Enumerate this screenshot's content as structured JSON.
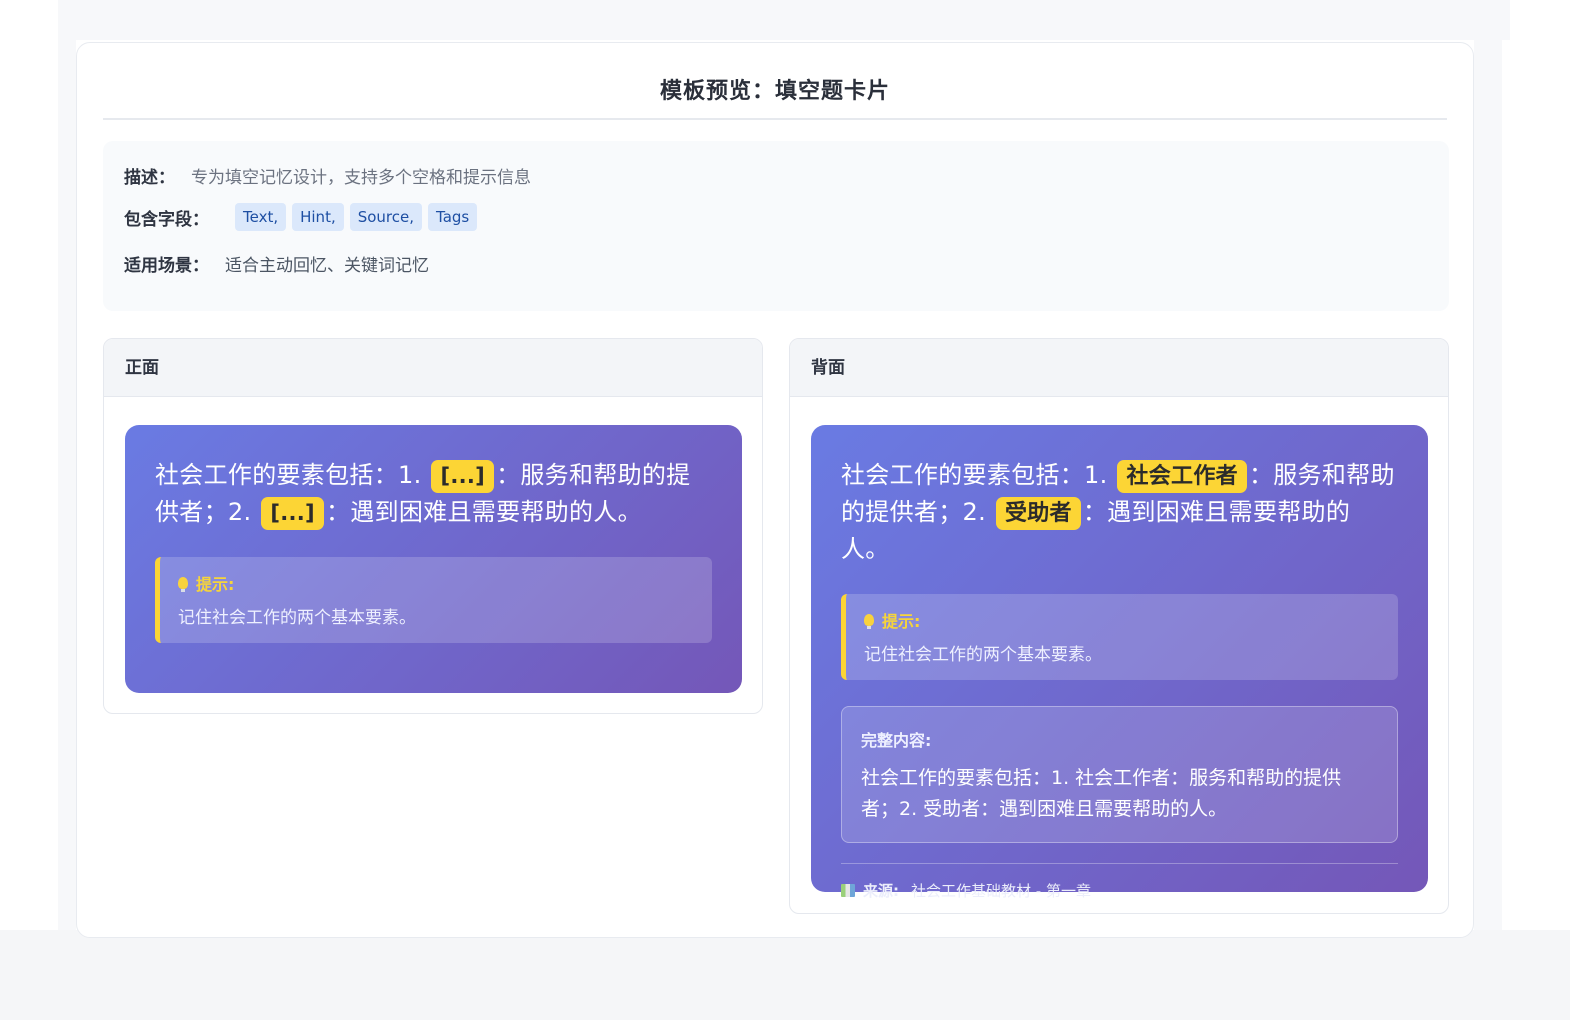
{
  "title": "模板预览：填空题卡片",
  "info": {
    "desc_key": "描述：",
    "desc_val": "专为填空记忆设计，支持多个空格和提示信息",
    "fields_key": "包含字段：",
    "fields": [
      "Text,",
      "Hint,",
      "Source,",
      "Tags"
    ],
    "scene_key": "适用场景：",
    "scene_val": "适合主动回忆、关键词记忆"
  },
  "front": {
    "label": "正面",
    "text_a": "社会工作的要素包括：1. ",
    "blank1": "[...]",
    "text_b": "：服务和帮助的提供者；2. ",
    "blank2": "[...]",
    "text_c": "：遇到困难且需要帮助的人。",
    "hint_label": "提示:",
    "hint_text": "记住社会工作的两个基本要素。"
  },
  "back": {
    "label": "背面",
    "text_a": "社会工作的要素包括：1. ",
    "answer1": "社会工作者",
    "text_b": "：服务和帮助的提供者；2. ",
    "answer2": "受助者",
    "text_c": "：遇到困难且需要帮助的人。",
    "hint_label": "提示:",
    "hint_text": "记住社会工作的两个基本要素。",
    "full_label": "完整内容:",
    "full_text": "社会工作的要素包括：1. 社会工作者：服务和帮助的提供者；2. 受助者：遇到困难且需要帮助的人。",
    "source_key": "来源:",
    "source_val": "社会工作基础教材 - 第一章"
  },
  "icons": {
    "hint": "lightbulb-icon",
    "source": "books-icon"
  },
  "colors": {
    "card_gradient_start": "#6a7be3",
    "card_gradient_end": "#7457b8",
    "blank_highlight": "#fcd535",
    "chip_bg": "#dbe8fb",
    "chip_text": "#1e4fa3"
  }
}
